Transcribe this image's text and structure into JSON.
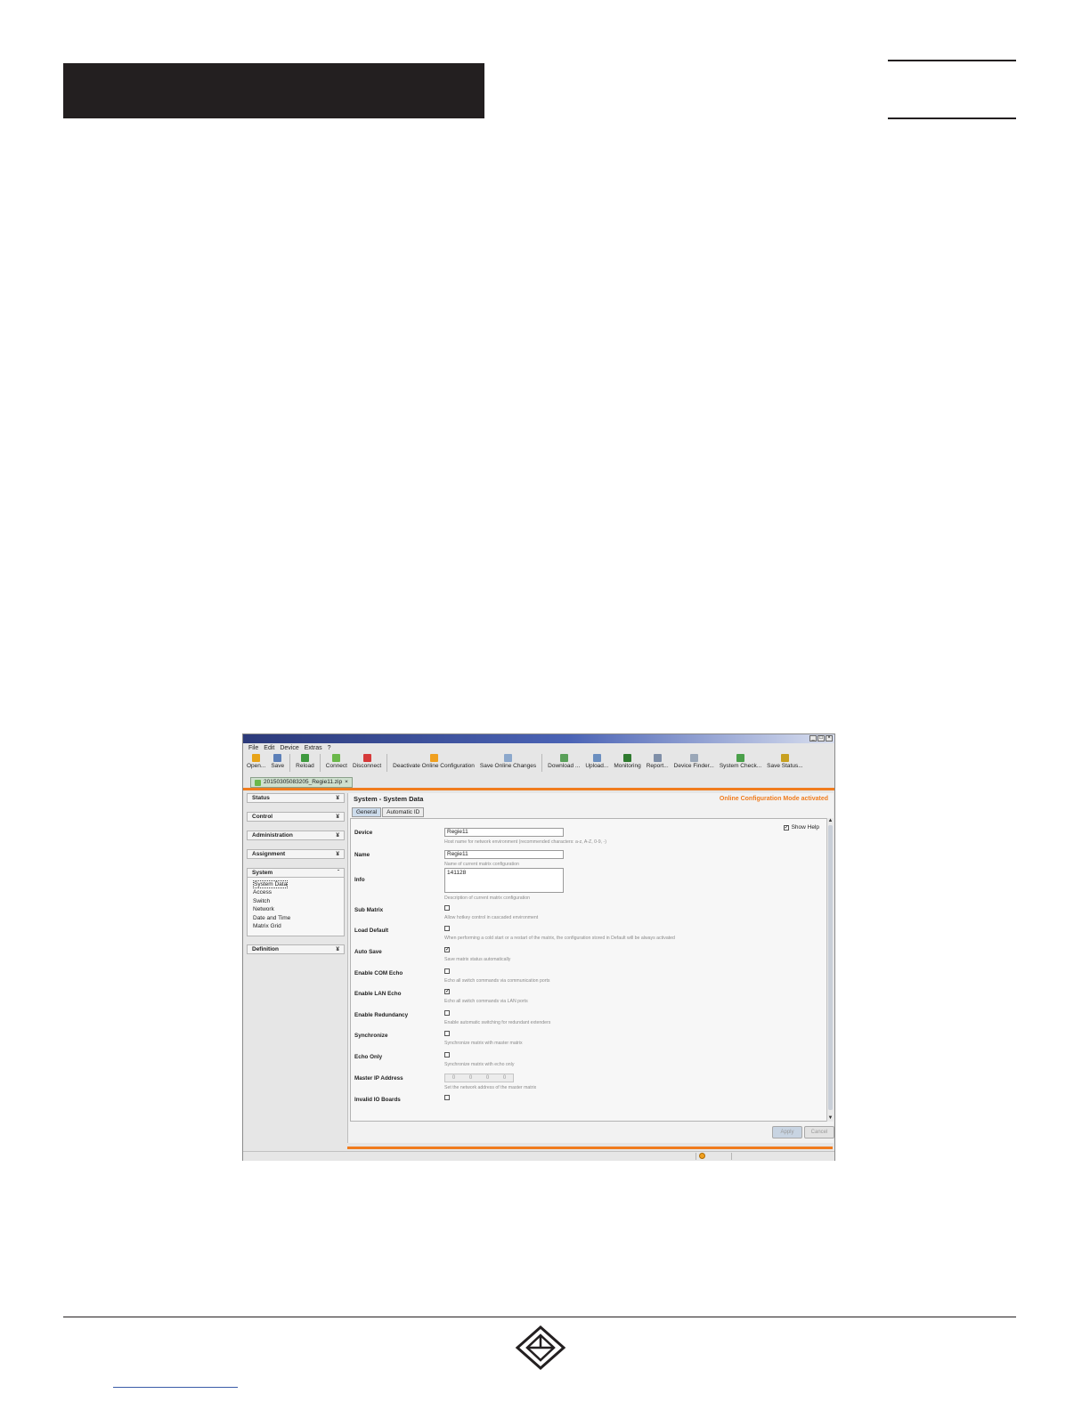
{
  "page": {
    "header_bar_text": "",
    "footer_link_text": ""
  },
  "window": {
    "buttons": [
      "_",
      "□",
      "×"
    ]
  },
  "menu": [
    "File",
    "Edit",
    "Device",
    "Extras",
    "?"
  ],
  "toolbar": [
    {
      "label": "Open...",
      "icon": "folder-open-icon",
      "color": "#e8a317"
    },
    {
      "label": "Save",
      "icon": "save-icon",
      "color": "#5c7fb8"
    },
    {
      "sep": true
    },
    {
      "label": "Reload",
      "icon": "reload-icon",
      "color": "#3f9a3f"
    },
    {
      "sep": true
    },
    {
      "label": "Connect",
      "icon": "connect-icon",
      "color": "#6bb84a"
    },
    {
      "label": "Disconnect",
      "icon": "disconnect-icon",
      "color": "#d63a3a"
    },
    {
      "sep": true
    },
    {
      "label": "Deactivate Online Configuration",
      "icon": "online-config-icon",
      "color": "#f0a020"
    },
    {
      "label": "Save Online Changes",
      "icon": "save-online-icon",
      "color": "#8ca8cc"
    },
    {
      "sep": true
    },
    {
      "label": "Download ...",
      "icon": "download-icon",
      "color": "#5aa05a"
    },
    {
      "label": "Upload...",
      "icon": "upload-icon",
      "color": "#6b8fc0"
    },
    {
      "label": "Monitoring",
      "icon": "monitoring-icon",
      "color": "#2f7a2f"
    },
    {
      "label": "Report...",
      "icon": "report-icon",
      "color": "#7f8fa8"
    },
    {
      "label": "Device Finder...",
      "icon": "device-finder-icon",
      "color": "#9aa7b8"
    },
    {
      "label": "System Check...",
      "icon": "system-check-icon",
      "color": "#4aa04a"
    },
    {
      "label": "Save Status...",
      "icon": "save-status-icon",
      "color": "#c8a020"
    }
  ],
  "doc_tab": {
    "label": "20150305083205_Regie11.zip",
    "close": "×"
  },
  "nav": {
    "sections": [
      {
        "label": "Status",
        "toggle": "¥"
      },
      {
        "label": "Control",
        "toggle": "¥"
      },
      {
        "label": "Administration",
        "toggle": "¥"
      },
      {
        "label": "Assignment",
        "toggle": "¥"
      },
      {
        "label": "System",
        "toggle": "ˆ",
        "open": true,
        "items": [
          "System Data",
          "Access",
          "Switch",
          "Network",
          "Date and Time",
          "Matrix Grid"
        ]
      },
      {
        "label": "Definition",
        "toggle": "¥"
      }
    ]
  },
  "main": {
    "title": "System - System Data",
    "mode": "Online Configuration Mode activated",
    "tabs": [
      "General",
      "Automatic ID"
    ],
    "show_help": "Show Help",
    "rows": [
      {
        "label": "Device",
        "type": "text",
        "value": "Regie11",
        "help": "Host name for network environment (recommended characters: a-z, A-Z, 0-9, -)"
      },
      {
        "label": "Name",
        "type": "text",
        "value": "Regie11",
        "help": "Name of current matrix configuration"
      },
      {
        "label": "Info",
        "type": "textarea",
        "value": "141128",
        "help": "Description of current matrix configuration"
      },
      {
        "label": "Sub Matrix",
        "type": "checkbox",
        "checked": false,
        "help": "Allow hotkey control in cascaded environment"
      },
      {
        "label": "Load Default",
        "type": "checkbox",
        "checked": false,
        "help": "When performing a cold start or a restart of the matrix, the configuration stored in Default will be always activated"
      },
      {
        "label": "Auto Save",
        "type": "checkbox",
        "checked": true,
        "help": "Save matrix status automatically"
      },
      {
        "label": "Enable COM Echo",
        "type": "checkbox",
        "checked": false,
        "help": "Echo all switch commands via communication ports"
      },
      {
        "label": "Enable LAN Echo",
        "type": "checkbox",
        "checked": true,
        "help": "Echo all switch commands via LAN ports"
      },
      {
        "label": "Enable Redundancy",
        "type": "checkbox",
        "checked": false,
        "help": "Enable automatic switching for redundant extenders"
      },
      {
        "label": "Synchronize",
        "type": "checkbox",
        "checked": false,
        "help": "Synchronize matrix with master matrix"
      },
      {
        "label": "Echo Only",
        "type": "checkbox",
        "checked": false,
        "help": "Synchronize matrix with echo only"
      },
      {
        "label": "Master IP Address",
        "type": "ip",
        "value": [
          "0",
          "0",
          "0",
          "0"
        ],
        "help": "Set the network address of the master matrix"
      },
      {
        "label": "Invalid IO Boards",
        "type": "checkbox",
        "checked": false,
        "help": ""
      }
    ],
    "apply_label": "Apply",
    "cancel_label": "Cancel"
  },
  "colors": {
    "accent": "#f07c1e",
    "title_bar": "#2c3a7a"
  }
}
